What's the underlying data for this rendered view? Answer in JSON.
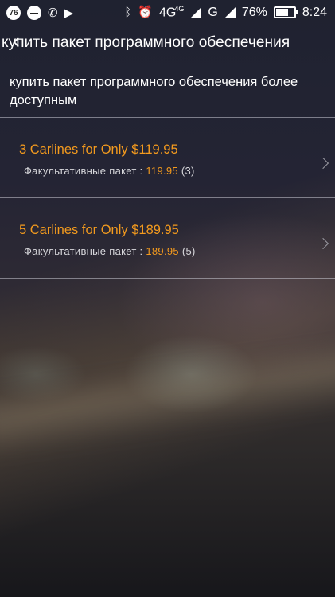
{
  "status_bar": {
    "notif_badge": "76",
    "network_1": "4G",
    "network_1_sup": "4G",
    "network_2": "G",
    "battery_percent": "76%",
    "battery_level": 0.76,
    "time": "8:24"
  },
  "app_bar": {
    "title": "купить  пакет программного обеспечения"
  },
  "intro": {
    "text": "купить  пакет программного обеспечения  более доступным"
  },
  "packages": [
    {
      "name": "3 Carlines for Only $119.95",
      "option_label": "Факультативные  пакет :",
      "price": "119.95",
      "count": "(3)"
    },
    {
      "name": "5 Carlines for Only $189.95",
      "option_label": "Факультативные  пакет :",
      "price": "189.95",
      "count": "(5)"
    }
  ],
  "colors": {
    "accent_orange": "#f39a1e"
  }
}
